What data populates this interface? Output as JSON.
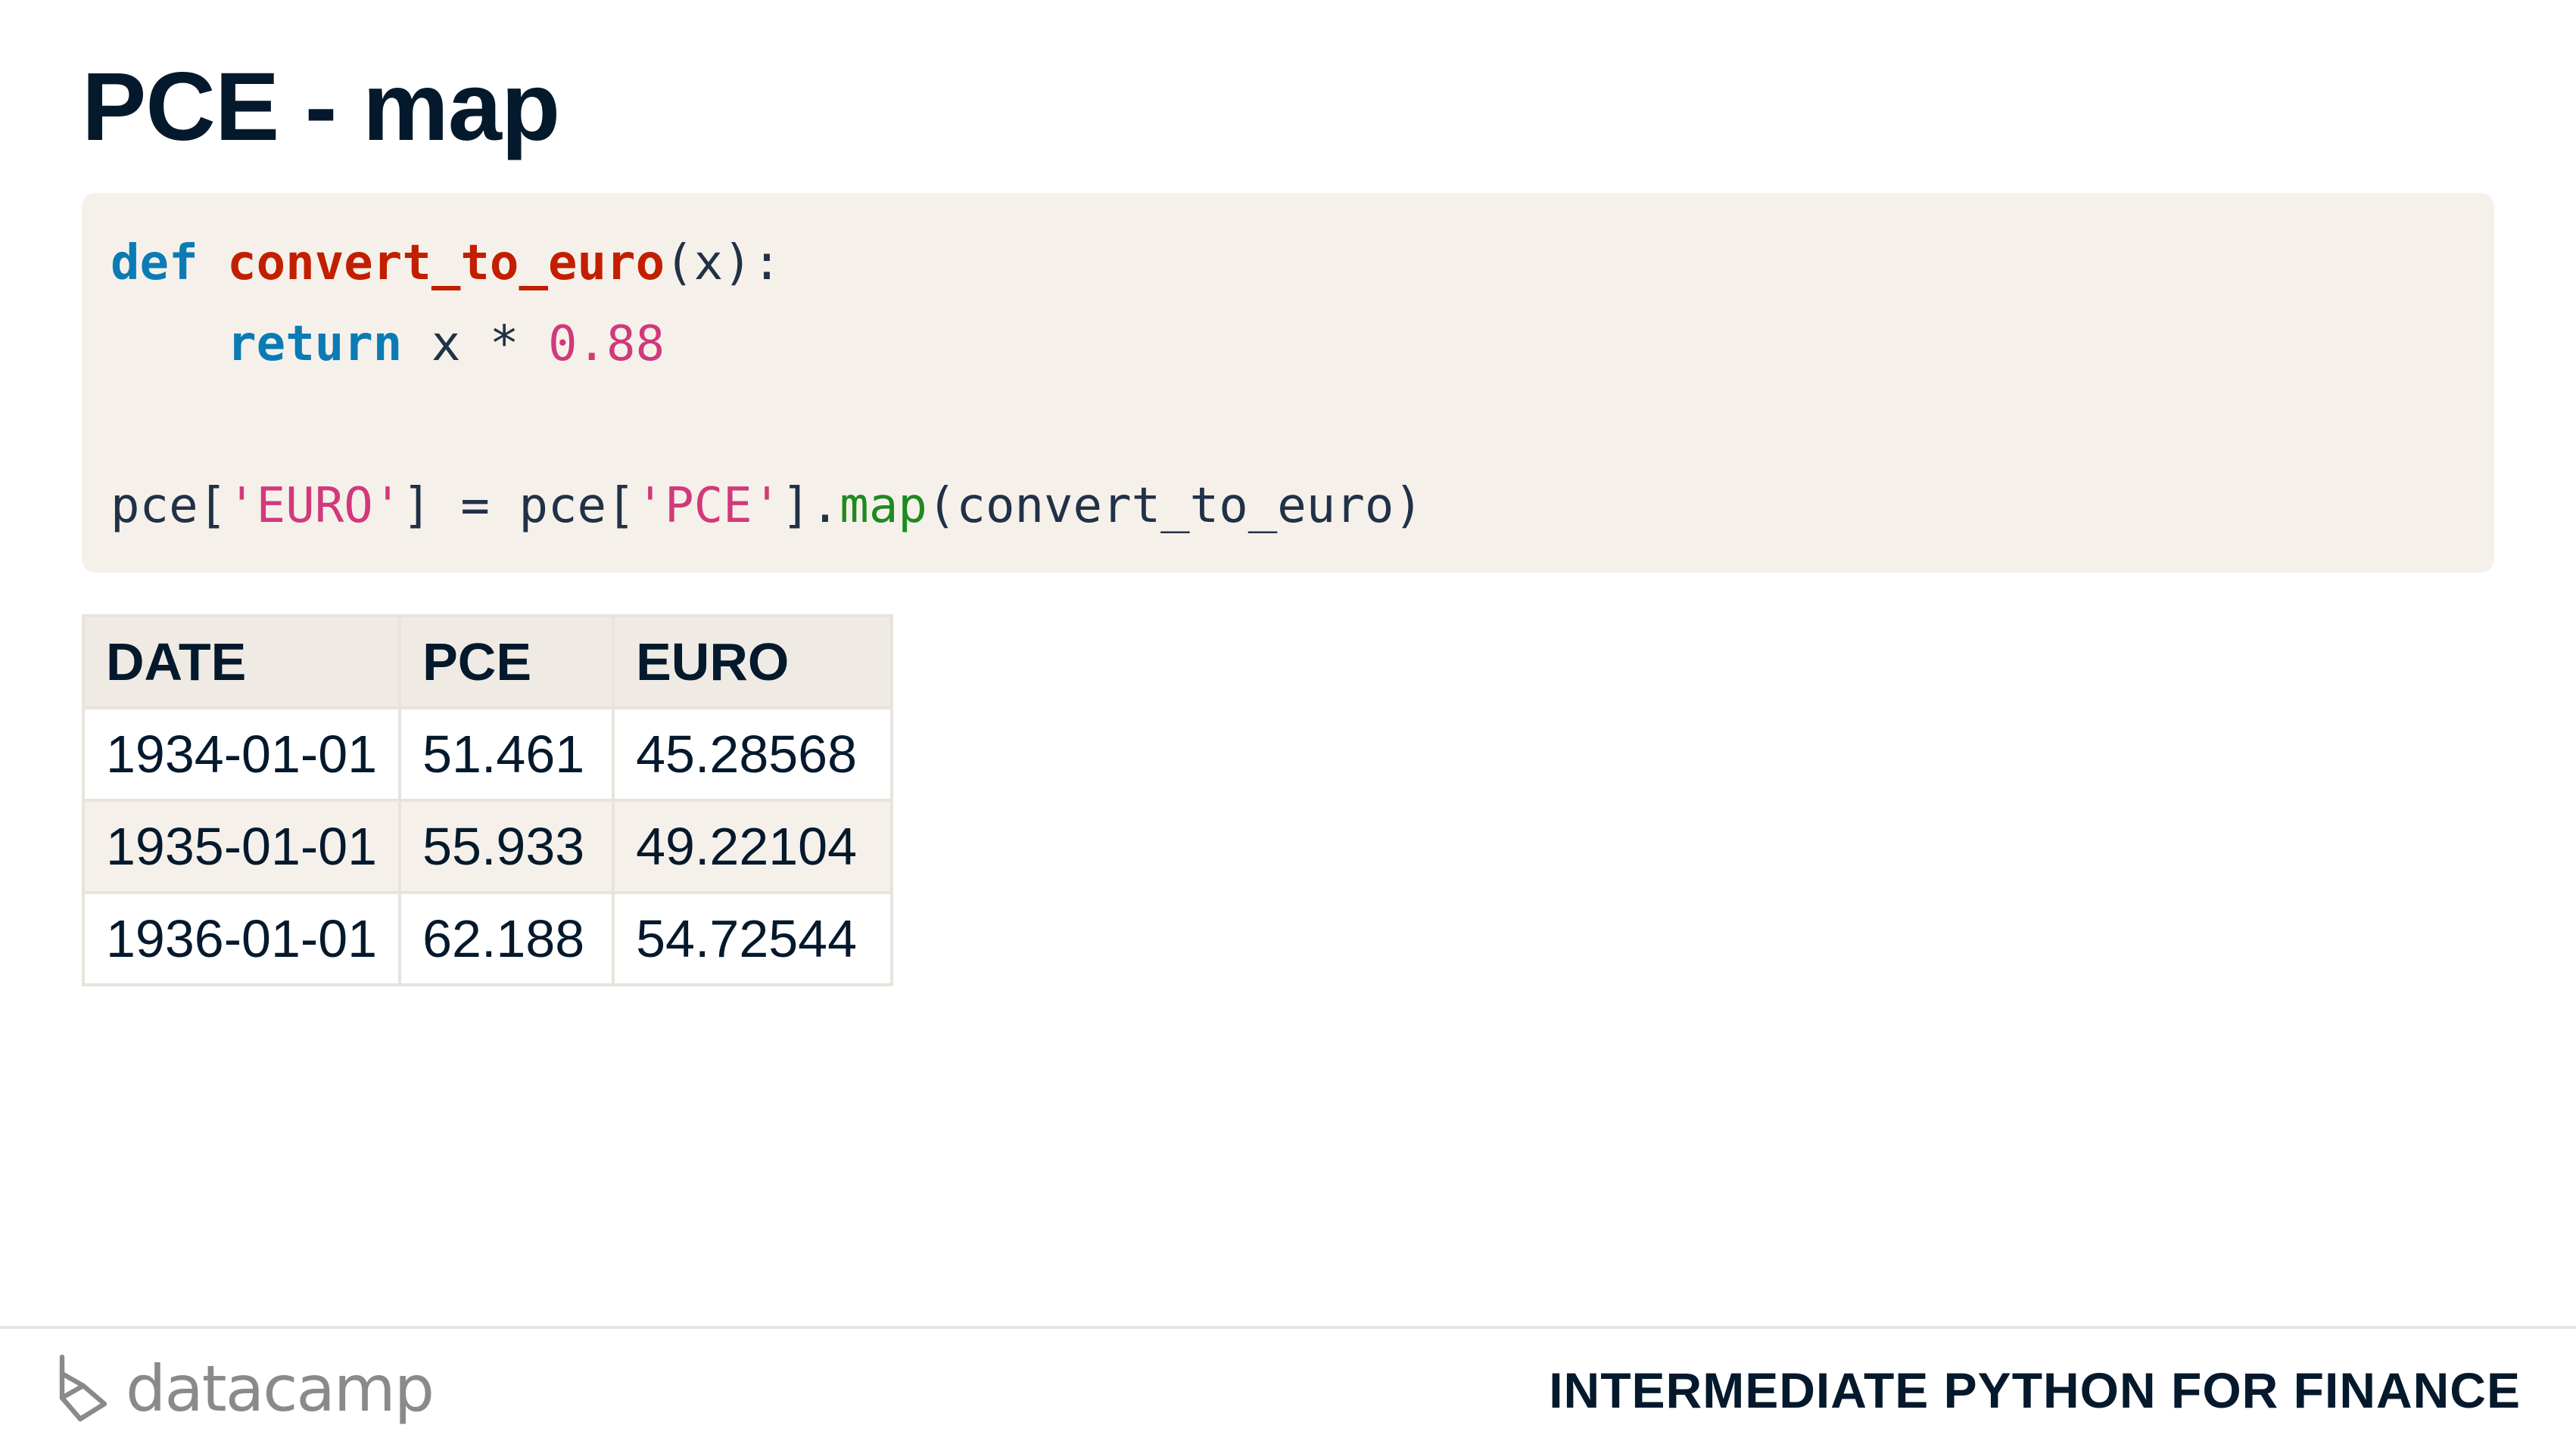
{
  "slide": {
    "title": "PCE - map"
  },
  "code": {
    "line1": {
      "kw": "def",
      "fn": "convert_to_euro",
      "rest": "(x):"
    },
    "line2": {
      "indent": "    ",
      "kw": "return",
      "mid": " x * ",
      "num": "0.88"
    },
    "line4": {
      "p1": "pce[",
      "s1": "'EURO'",
      "p2": "] = pce[",
      "s2": "'PCE'",
      "p3": "].",
      "method": "map",
      "p4": "(convert_to_euro)"
    }
  },
  "table": {
    "headers": [
      "DATE",
      "PCE",
      "EURO"
    ],
    "rows": [
      [
        "1934-01-01",
        "51.461",
        "45.28568"
      ],
      [
        "1935-01-01",
        "55.933",
        "49.22104"
      ],
      [
        "1936-01-01",
        "62.188",
        "54.72544"
      ]
    ]
  },
  "footer": {
    "logo_text": "datacamp",
    "course_title": "INTERMEDIATE PYTHON FOR FINANCE"
  },
  "colors": {
    "code_background": "#f5f1ea",
    "keyword": "#0b7bb5",
    "function_name": "#c21f00",
    "string_number": "#d1397a",
    "method": "#1f8a1f",
    "text": "#05192d"
  },
  "icons": {
    "logo": "datacamp-logo-icon"
  }
}
